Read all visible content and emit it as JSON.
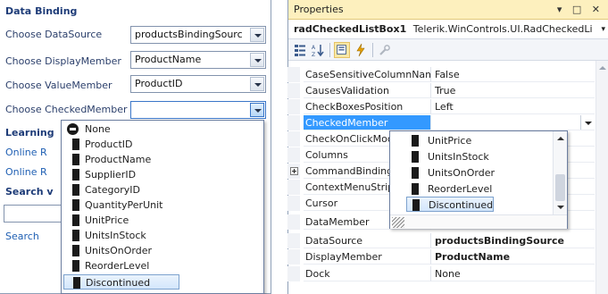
{
  "left": {
    "section_title": "Data Binding",
    "rows": [
      {
        "label": "Choose DataSource",
        "value": "productsBindingSourc"
      },
      {
        "label": "Choose DisplayMember",
        "value": "ProductName"
      },
      {
        "label": "Choose ValueMember",
        "value": "ProductID"
      },
      {
        "label": "Choose CheckedMember",
        "value": ""
      }
    ],
    "learning_title": "Learning",
    "links": [
      "Online R",
      "Online R"
    ],
    "search_title": "Search v",
    "search_link": "Search",
    "dropdown": {
      "items": [
        "None",
        "ProductID",
        "ProductName",
        "SupplierID",
        "CategoryID",
        "QuantityPerUnit",
        "UnitPrice",
        "UnitsInStock",
        "UnitsOnOrder",
        "ReorderLevel",
        "Discontinued"
      ],
      "selected": "Discontinued"
    }
  },
  "right": {
    "title": "Properties",
    "title_buttons": "▾ □ ✕",
    "object_name": "radCheckedListBox1",
    "object_type": "Telerik.WinControls.UI.RadCheckedLi",
    "object_chevron": "▾",
    "rows": [
      {
        "name": "CaseSensitiveColumnNam",
        "value": "False"
      },
      {
        "name": "CausesValidation",
        "value": "True"
      },
      {
        "name": "CheckBoxesPosition",
        "value": "Left"
      },
      {
        "name": "CheckedMember",
        "value": ""
      },
      {
        "name": "CheckOnClickMod",
        "value": ""
      },
      {
        "name": "Columns",
        "value": ""
      },
      {
        "name": "CommandBinding",
        "value": ""
      },
      {
        "name": "ContextMenuStrip",
        "value": ""
      },
      {
        "name": "Cursor",
        "value": ""
      },
      {
        "name": "DataMember",
        "value": ""
      },
      {
        "name": "DataSource",
        "value": "productsBindingSource"
      },
      {
        "name": "DisplayMember",
        "value": "ProductName"
      },
      {
        "name": "Dock",
        "value": "None"
      }
    ],
    "dropdown": {
      "items": [
        "UnitPrice",
        "UnitsInStock",
        "UnitsOnOrder",
        "ReorderLevel",
        "Discontinued"
      ],
      "selected": "Discontinued"
    }
  }
}
